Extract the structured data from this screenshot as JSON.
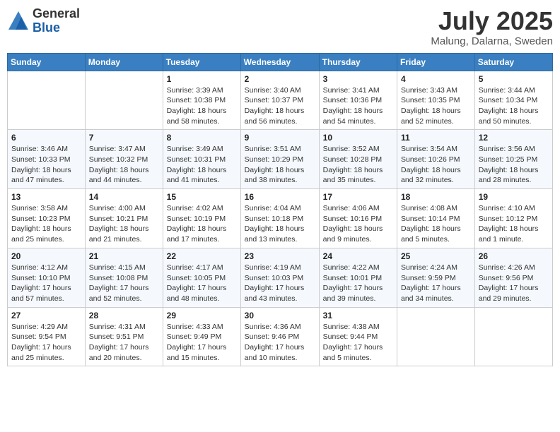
{
  "logo": {
    "general": "General",
    "blue": "Blue"
  },
  "title": "July 2025",
  "location": "Malung, Dalarna, Sweden",
  "days_of_week": [
    "Sunday",
    "Monday",
    "Tuesday",
    "Wednesday",
    "Thursday",
    "Friday",
    "Saturday"
  ],
  "weeks": [
    [
      {
        "day": "",
        "info": ""
      },
      {
        "day": "",
        "info": ""
      },
      {
        "day": "1",
        "info": "Sunrise: 3:39 AM\nSunset: 10:38 PM\nDaylight: 18 hours\nand 58 minutes."
      },
      {
        "day": "2",
        "info": "Sunrise: 3:40 AM\nSunset: 10:37 PM\nDaylight: 18 hours\nand 56 minutes."
      },
      {
        "day": "3",
        "info": "Sunrise: 3:41 AM\nSunset: 10:36 PM\nDaylight: 18 hours\nand 54 minutes."
      },
      {
        "day": "4",
        "info": "Sunrise: 3:43 AM\nSunset: 10:35 PM\nDaylight: 18 hours\nand 52 minutes."
      },
      {
        "day": "5",
        "info": "Sunrise: 3:44 AM\nSunset: 10:34 PM\nDaylight: 18 hours\nand 50 minutes."
      }
    ],
    [
      {
        "day": "6",
        "info": "Sunrise: 3:46 AM\nSunset: 10:33 PM\nDaylight: 18 hours\nand 47 minutes."
      },
      {
        "day": "7",
        "info": "Sunrise: 3:47 AM\nSunset: 10:32 PM\nDaylight: 18 hours\nand 44 minutes."
      },
      {
        "day": "8",
        "info": "Sunrise: 3:49 AM\nSunset: 10:31 PM\nDaylight: 18 hours\nand 41 minutes."
      },
      {
        "day": "9",
        "info": "Sunrise: 3:51 AM\nSunset: 10:29 PM\nDaylight: 18 hours\nand 38 minutes."
      },
      {
        "day": "10",
        "info": "Sunrise: 3:52 AM\nSunset: 10:28 PM\nDaylight: 18 hours\nand 35 minutes."
      },
      {
        "day": "11",
        "info": "Sunrise: 3:54 AM\nSunset: 10:26 PM\nDaylight: 18 hours\nand 32 minutes."
      },
      {
        "day": "12",
        "info": "Sunrise: 3:56 AM\nSunset: 10:25 PM\nDaylight: 18 hours\nand 28 minutes."
      }
    ],
    [
      {
        "day": "13",
        "info": "Sunrise: 3:58 AM\nSunset: 10:23 PM\nDaylight: 18 hours\nand 25 minutes."
      },
      {
        "day": "14",
        "info": "Sunrise: 4:00 AM\nSunset: 10:21 PM\nDaylight: 18 hours\nand 21 minutes."
      },
      {
        "day": "15",
        "info": "Sunrise: 4:02 AM\nSunset: 10:19 PM\nDaylight: 18 hours\nand 17 minutes."
      },
      {
        "day": "16",
        "info": "Sunrise: 4:04 AM\nSunset: 10:18 PM\nDaylight: 18 hours\nand 13 minutes."
      },
      {
        "day": "17",
        "info": "Sunrise: 4:06 AM\nSunset: 10:16 PM\nDaylight: 18 hours\nand 9 minutes."
      },
      {
        "day": "18",
        "info": "Sunrise: 4:08 AM\nSunset: 10:14 PM\nDaylight: 18 hours\nand 5 minutes."
      },
      {
        "day": "19",
        "info": "Sunrise: 4:10 AM\nSunset: 10:12 PM\nDaylight: 18 hours\nand 1 minute."
      }
    ],
    [
      {
        "day": "20",
        "info": "Sunrise: 4:12 AM\nSunset: 10:10 PM\nDaylight: 17 hours\nand 57 minutes."
      },
      {
        "day": "21",
        "info": "Sunrise: 4:15 AM\nSunset: 10:08 PM\nDaylight: 17 hours\nand 52 minutes."
      },
      {
        "day": "22",
        "info": "Sunrise: 4:17 AM\nSunset: 10:05 PM\nDaylight: 17 hours\nand 48 minutes."
      },
      {
        "day": "23",
        "info": "Sunrise: 4:19 AM\nSunset: 10:03 PM\nDaylight: 17 hours\nand 43 minutes."
      },
      {
        "day": "24",
        "info": "Sunrise: 4:22 AM\nSunset: 10:01 PM\nDaylight: 17 hours\nand 39 minutes."
      },
      {
        "day": "25",
        "info": "Sunrise: 4:24 AM\nSunset: 9:59 PM\nDaylight: 17 hours\nand 34 minutes."
      },
      {
        "day": "26",
        "info": "Sunrise: 4:26 AM\nSunset: 9:56 PM\nDaylight: 17 hours\nand 29 minutes."
      }
    ],
    [
      {
        "day": "27",
        "info": "Sunrise: 4:29 AM\nSunset: 9:54 PM\nDaylight: 17 hours\nand 25 minutes."
      },
      {
        "day": "28",
        "info": "Sunrise: 4:31 AM\nSunset: 9:51 PM\nDaylight: 17 hours\nand 20 minutes."
      },
      {
        "day": "29",
        "info": "Sunrise: 4:33 AM\nSunset: 9:49 PM\nDaylight: 17 hours\nand 15 minutes."
      },
      {
        "day": "30",
        "info": "Sunrise: 4:36 AM\nSunset: 9:46 PM\nDaylight: 17 hours\nand 10 minutes."
      },
      {
        "day": "31",
        "info": "Sunrise: 4:38 AM\nSunset: 9:44 PM\nDaylight: 17 hours\nand 5 minutes."
      },
      {
        "day": "",
        "info": ""
      },
      {
        "day": "",
        "info": ""
      }
    ]
  ]
}
